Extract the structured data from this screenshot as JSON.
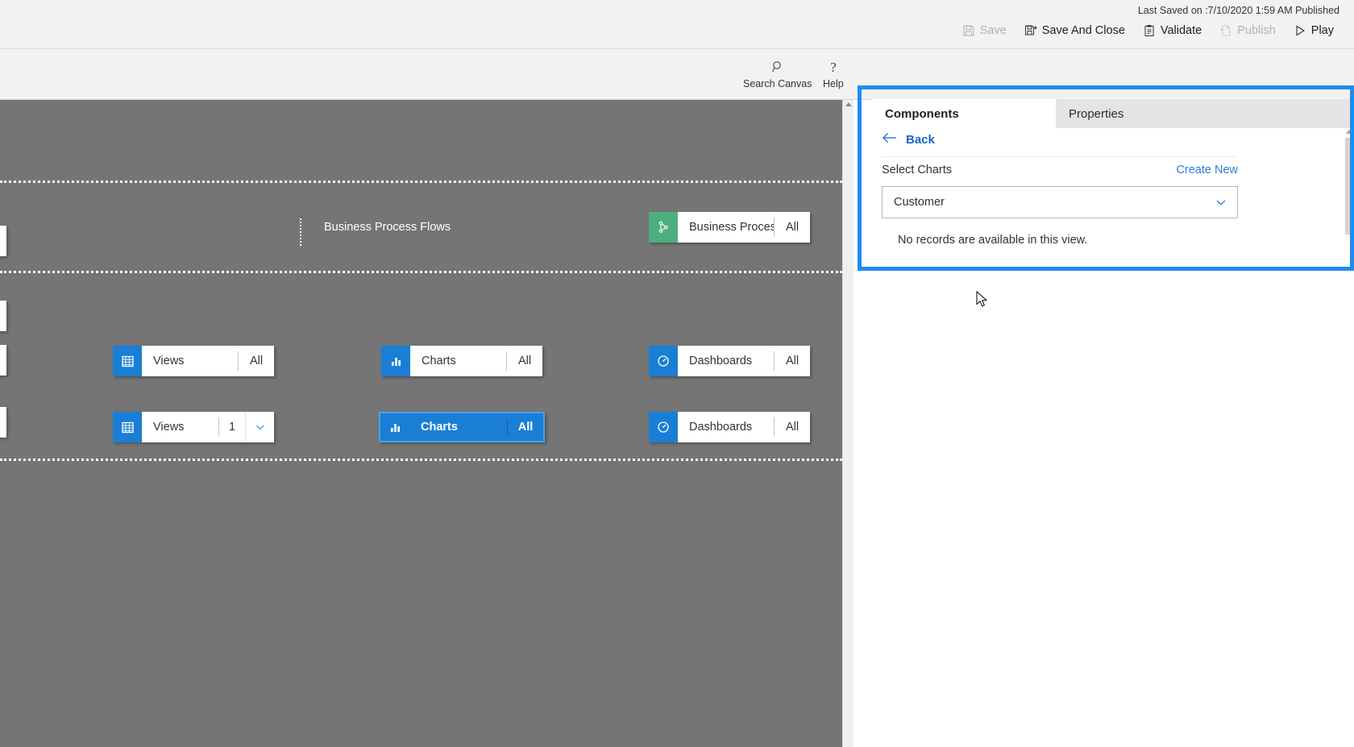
{
  "topbar": {
    "saved_status": "Last Saved on :7/10/2020 1:59 AM Published",
    "commands": [
      {
        "id": "save",
        "label": "Save",
        "icon": "save-icon",
        "disabled": true
      },
      {
        "id": "save-and-close",
        "label": "Save And Close",
        "icon": "save-and-close-icon",
        "disabled": false
      },
      {
        "id": "validate",
        "label": "Validate",
        "icon": "validate-icon",
        "disabled": false
      },
      {
        "id": "publish",
        "label": "Publish",
        "icon": "publish-icon",
        "disabled": true
      },
      {
        "id": "play",
        "label": "Play",
        "icon": "play-icon",
        "disabled": false
      }
    ]
  },
  "secondbar": {
    "tools": [
      {
        "id": "search-canvas",
        "label": "Search Canvas",
        "icon": "search-icon"
      },
      {
        "id": "help",
        "label": "Help",
        "icon": "question-mark-icon"
      }
    ]
  },
  "canvas": {
    "background_color": "#757575",
    "sections": [
      {
        "id": "business-process-flows",
        "label": "Business Process Flows",
        "chips": [
          {
            "id": "business-process-flows-chip",
            "name": "Business Proces...",
            "count": "All",
            "icon": "process-flow-icon",
            "icon_color": "#4caf7d",
            "selected": false,
            "has_chevron": false
          }
        ]
      },
      {
        "id": "data-row-1",
        "label": "",
        "chips": [
          {
            "id": "views-chip-1",
            "name": "Views",
            "count": "All",
            "icon": "grid-icon",
            "icon_color": "#1a7fd4",
            "selected": false,
            "has_chevron": false
          },
          {
            "id": "charts-chip-1",
            "name": "Charts",
            "count": "All",
            "icon": "bar-chart-icon",
            "icon_color": "#1a7fd4",
            "selected": false,
            "has_chevron": false
          },
          {
            "id": "dashboards-chip-1",
            "name": "Dashboards",
            "count": "All",
            "icon": "gauge-icon",
            "icon_color": "#1a7fd4",
            "selected": false,
            "has_chevron": false
          }
        ]
      },
      {
        "id": "data-row-2",
        "label": "",
        "chips": [
          {
            "id": "views-chip-2",
            "name": "Views",
            "count": "1",
            "icon": "grid-icon",
            "icon_color": "#1a7fd4",
            "selected": false,
            "has_chevron": true
          },
          {
            "id": "charts-chip-2",
            "name": "Charts",
            "count": "All",
            "icon": "bar-chart-icon",
            "icon_color": "#1a7fd4",
            "selected": true,
            "has_chevron": false
          },
          {
            "id": "dashboards-chip-2",
            "name": "Dashboards",
            "count": "All",
            "icon": "gauge-icon",
            "icon_color": "#1a7fd4",
            "selected": false,
            "has_chevron": false
          }
        ]
      }
    ]
  },
  "panel": {
    "tabs": [
      {
        "id": "components",
        "label": "Components",
        "active": true
      },
      {
        "id": "properties",
        "label": "Properties",
        "active": false
      }
    ],
    "back_label": "Back",
    "select_label": "Select Charts",
    "create_new_label": "Create New",
    "combobox_value": "Customer",
    "empty_message": "No records are available in this view.",
    "highlight_color": "#1f8cf0"
  }
}
